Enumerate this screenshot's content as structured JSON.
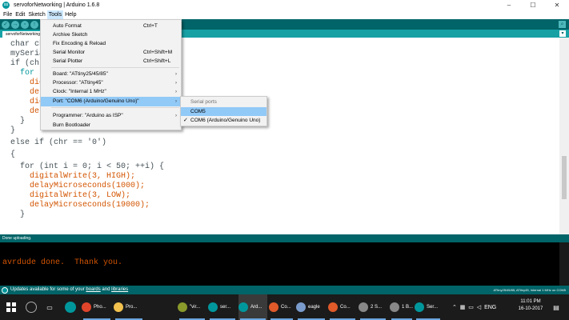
{
  "window": {
    "title": "servoforNetworking | Arduino 1.6.8",
    "controls": {
      "minimize": "–",
      "maximize": "☐",
      "close": "✕"
    }
  },
  "menubar": [
    "File",
    "Edit",
    "Sketch",
    "Tools",
    "Help"
  ],
  "toolbar": {
    "buttons": [
      {
        "name": "verify-icon",
        "glyph": "✓"
      },
      {
        "name": "upload-icon",
        "glyph": "→"
      },
      {
        "name": "new-icon",
        "glyph": "▫"
      },
      {
        "name": "open-icon",
        "glyph": "↑"
      },
      {
        "name": "save-icon",
        "glyph": "↓"
      }
    ],
    "serial_monitor_glyph": "⌕"
  },
  "tab": {
    "label": "servoforNetworking",
    "menu_glyph": "▾"
  },
  "editor": {
    "lines": [
      "char ch",
      "mySeria",
      "if (chr",
      "  for",
      "    dic",
      "    del",
      "    dic",
      "    del",
      "  }",
      "}",
      "else if (chr == '0')",
      "{",
      "  for (int i = 0; i < 50; ++i) {",
      "    digitalWrite(3, HIGH);",
      "    delayMicroseconds(1000);",
      "    digitalWrite(3, LOW);",
      "    delayMicroseconds(19000);",
      "  }"
    ]
  },
  "message_bar": {
    "text": "Done uploading."
  },
  "console": {
    "lines": [
      "avrdude done.  Thank you."
    ]
  },
  "status": {
    "notice_prefix": "Updates available for some of your",
    "boards_link": "boards",
    "and": "and",
    "libraries_link": "libraries",
    "board_info": "ATtiny25/45/85, ATtiny45, Internal 1 MHz on COM5"
  },
  "tools_menu": {
    "items": [
      {
        "label": "Auto Format",
        "shortcut": "Ctrl+T",
        "arrow": ""
      },
      {
        "label": "Archive Sketch",
        "shortcut": "",
        "arrow": ""
      },
      {
        "label": "Fix Encoding & Reload",
        "shortcut": "",
        "arrow": ""
      },
      {
        "label": "Serial Monitor",
        "shortcut": "Ctrl+Shift+M",
        "arrow": ""
      },
      {
        "label": "Serial Plotter",
        "shortcut": "Ctrl+Shift+L",
        "arrow": ""
      },
      {
        "label": "Board: \"ATtiny25/45/85\"",
        "shortcut": "",
        "arrow": "›"
      },
      {
        "label": "Processor: \"ATtiny45\"",
        "shortcut": "",
        "arrow": "›"
      },
      {
        "label": "Clock: \"Internal 1 MHz\"",
        "shortcut": "",
        "arrow": "›"
      },
      {
        "label": "Port: \"COM6 (Arduino/Genuino Uno)\"",
        "shortcut": "",
        "arrow": "›"
      },
      {
        "label": "Programmer: \"Arduino as ISP\"",
        "shortcut": "",
        "arrow": "›"
      },
      {
        "label": "Burn Bootloader",
        "shortcut": "",
        "arrow": ""
      }
    ]
  },
  "port_submenu": {
    "header": "Serial ports",
    "items": [
      {
        "label": "COM5",
        "checked": ""
      },
      {
        "label": "COM6 (Arduino/Genuino Uno)",
        "checked": "✓"
      }
    ]
  },
  "taskbar": {
    "apps": [
      {
        "label": "Pho...",
        "color": "#e0452b"
      },
      {
        "label": "Pro...",
        "color": "#f2c14e"
      },
      {
        "label": "\"vir...",
        "color": "#8a9a2b"
      },
      {
        "label": "ser...",
        "color": "#00979c"
      },
      {
        "label": "Ard...",
        "color": "#00979c"
      },
      {
        "label": "Co...",
        "color": "#e05a2a"
      },
      {
        "label": "eagle",
        "color": "#7a9ccc"
      },
      {
        "label": "Co...",
        "color": "#e05a2a"
      },
      {
        "label": "2 S...",
        "color": "#888888"
      },
      {
        "label": "1 B...",
        "color": "#888888"
      },
      {
        "label": "Ser...",
        "color": "#00979c"
      }
    ],
    "lang": "ENG",
    "time": "11:01 PM",
    "date": "16-10-2017"
  },
  "colors": {
    "arduino_teal": "#006468",
    "arduino_tab_bar": "#17a1a5",
    "menu_highlight": "#91c9f7",
    "console_text": "#d35400"
  }
}
